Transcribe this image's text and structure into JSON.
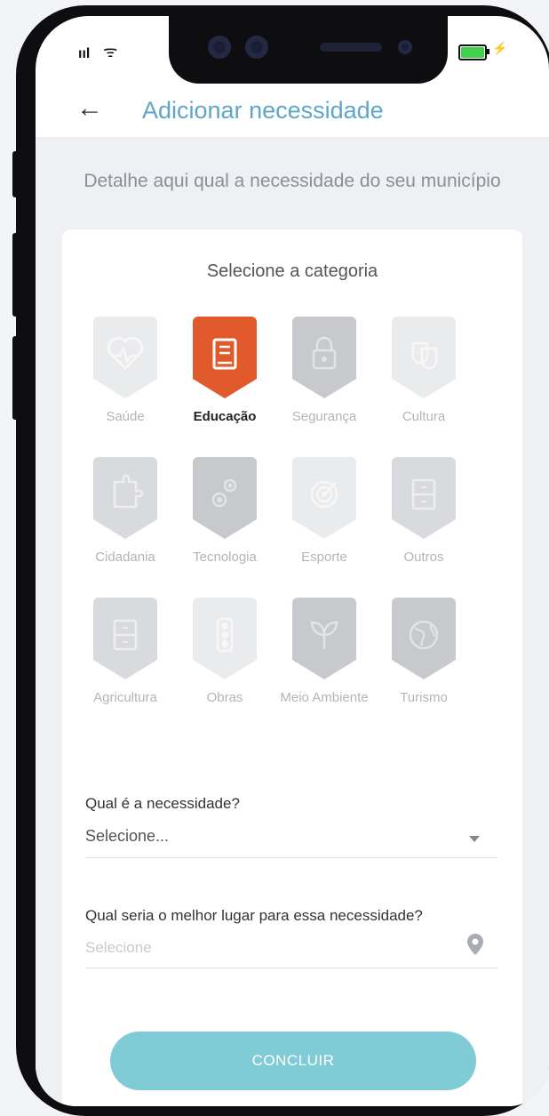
{
  "status_bar": {
    "signal": "ııl",
    "wifi": "ᯤ"
  },
  "header": {
    "back_icon": "←",
    "title": "Adicionar necessidade"
  },
  "subtitle": "Detalhe aqui qual a necessidade do seu município",
  "category_section": {
    "title": "Selecione a categoria",
    "selected": "Educação",
    "items": [
      {
        "label": "Saúde",
        "icon": "heart-pulse-icon",
        "tone": "light"
      },
      {
        "label": "Educação",
        "icon": "book-icon",
        "tone": "active"
      },
      {
        "label": "Segurança",
        "icon": "lock-icon",
        "tone": "dark"
      },
      {
        "label": "Cultura",
        "icon": "theater-masks-icon",
        "tone": "light"
      },
      {
        "label": "Cidadania",
        "icon": "puzzle-icon",
        "tone": "medium"
      },
      {
        "label": "Tecnologia",
        "icon": "gears-icon",
        "tone": "dark"
      },
      {
        "label": "Esporte",
        "icon": "target-icon",
        "tone": "light"
      },
      {
        "label": "Outros",
        "icon": "cabinet-icon",
        "tone": "medium"
      },
      {
        "label": "Agricultura",
        "icon": "cabinet-icon",
        "tone": "medium"
      },
      {
        "label": "Obras",
        "icon": "traffic-light-icon",
        "tone": "light"
      },
      {
        "label": "Meio Ambiente",
        "icon": "sprout-icon",
        "tone": "dark"
      },
      {
        "label": "Turismo",
        "icon": "globe-icon",
        "tone": "dark"
      }
    ]
  },
  "need_field": {
    "label": "Qual é a necessidade?",
    "value": "Selecione..."
  },
  "place_field": {
    "label": "Qual seria o melhor lugar para essa necessidade?",
    "placeholder": "Selecione"
  },
  "submit": {
    "label": "CONCLUIR"
  },
  "colors": {
    "title": "#5fa6c7",
    "active_category": "#e05a2b",
    "button": "#7fcbd6",
    "background": "#eef0f3"
  }
}
